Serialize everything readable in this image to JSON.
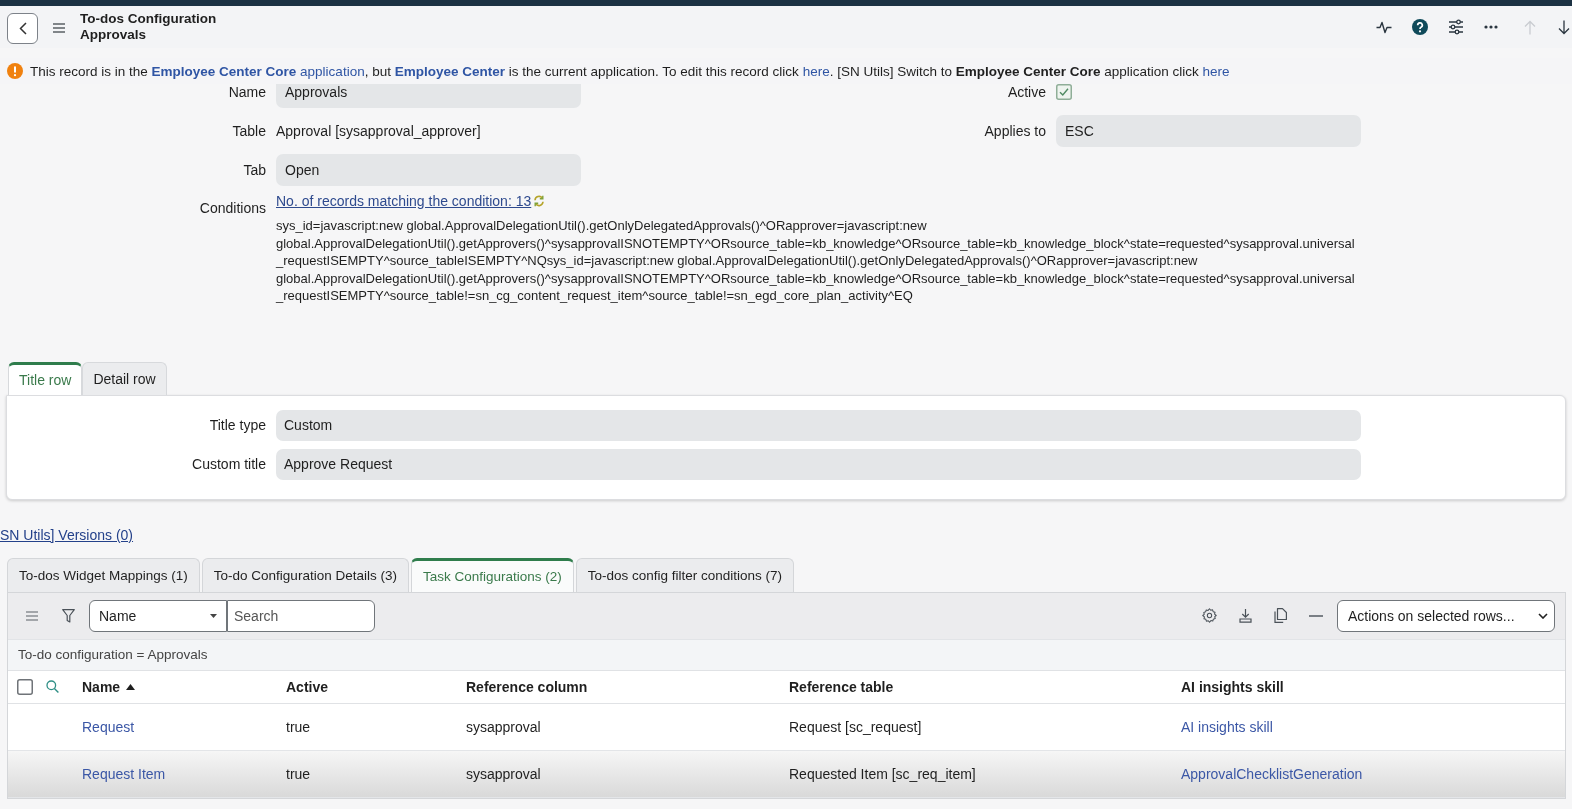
{
  "header": {
    "title": "To-dos Configuration",
    "subtitle": "Approvals",
    "previous_disabled": true,
    "next_disabled": false
  },
  "info_message": {
    "parts": [
      {
        "kind": "text",
        "text": "This record is in the "
      },
      {
        "kind": "link",
        "bold": false,
        "text": "**Employee Center Core** application"
      },
      {
        "kind": "text",
        "text": ", but "
      },
      {
        "kind": "link",
        "bold": true,
        "text": "Employee Center"
      },
      {
        "kind": "text",
        "text": " is the current application. To edit this record click "
      },
      {
        "kind": "link",
        "bold": false,
        "text": "here"
      },
      {
        "kind": "text",
        "text": ".  [SN Utils] Switch to **Employee Center Core** application click "
      },
      {
        "kind": "link",
        "bold": false,
        "text": "here"
      }
    ]
  },
  "form": {
    "left_fields": [
      {
        "kind": "input",
        "label": "Name",
        "value": "Approvals"
      },
      {
        "kind": "text",
        "label": "Table",
        "value": "Approval [sysapproval_approver]"
      },
      {
        "kind": "input",
        "label": "Tab",
        "value": "Open"
      }
    ],
    "right_fields": [
      {
        "kind": "checkbox",
        "label": "Active",
        "checked": true
      },
      {
        "kind": "input",
        "label": "Applies to",
        "value": "ESC"
      }
    ],
    "conditions": {
      "label": "Conditions",
      "count_link": "No. of records matching the condition: 13",
      "query": "sys_id=javascript:new global.ApprovalDelegationUtil().getOnlyDelegatedApprovals()^ORapprover=javascript:new global.ApprovalDelegationUtil().getApprovers()^sysapprovalISNOTEMPTY^ORsource_table=kb_knowledge^ORsource_table=kb_knowledge_block^state=requested^sysapproval.universal_requestISEMPTY^source_tableISEMPTY^NQsys_id=javascript:new global.ApprovalDelegationUtil().getOnlyDelegatedApprovals()^ORapprover=javascript:new global.ApprovalDelegationUtil().getApprovers()^sysapprovalISNOTEMPTY^ORsource_table=kb_knowledge^ORsource_table=kb_knowledge_block^state=requested^sysapproval.universal_requestISEMPTY^source_table!=sn_cg_content_request_item^source_table!=sn_egd_core_plan_activity^EQ"
    }
  },
  "section_tabs": [
    {
      "label": "Title row",
      "selected": true
    },
    {
      "label": "Detail row",
      "selected": false
    }
  ],
  "section_fields": [
    {
      "label": "Title type",
      "value": "Custom"
    },
    {
      "label": "Custom title",
      "value": "Approve Request"
    }
  ],
  "versions_link": "SN Utils] Versions (0)",
  "related_lists": {
    "tabs": [
      {
        "label": "To-dos Widget Mappings (1)",
        "selected": false
      },
      {
        "label": "To-do Configuration Details (3)",
        "selected": false
      },
      {
        "label": "Task Configurations (2)",
        "selected": true
      },
      {
        "label": "To-dos config filter conditions (7)",
        "selected": false
      }
    ],
    "toolbar": {
      "field_select": "Name",
      "search_placeholder": "Search",
      "actions_select": "Actions on selected rows..."
    },
    "breadcrumb": "To-do configuration = Approvals",
    "table": {
      "select_all_checked": false,
      "columns": [
        {
          "label": "Name",
          "sorted_ascending": true
        },
        {
          "label": "Active",
          "sorted_ascending": false
        },
        {
          "label": "Reference column",
          "sorted_ascending": false
        },
        {
          "label": "Reference table",
          "sorted_ascending": false
        },
        {
          "label": "AI insights skill",
          "sorted_ascending": false
        }
      ],
      "rows": [
        {
          "hovered": false,
          "cells": [
            {
              "kind": "link",
              "text": "Request"
            },
            {
              "kind": "text",
              "text": "true"
            },
            {
              "kind": "text",
              "text": "sysapproval"
            },
            {
              "kind": "text",
              "text": "Request [sc_request]"
            },
            {
              "kind": "link",
              "text": "AI insights skill"
            }
          ]
        },
        {
          "hovered": true,
          "cells": [
            {
              "kind": "link",
              "text": "Request Item"
            },
            {
              "kind": "text",
              "text": "true"
            },
            {
              "kind": "text",
              "text": "sysapproval"
            },
            {
              "kind": "text",
              "text": "Requested Item [sc_req_item]"
            },
            {
              "kind": "link",
              "text": "ApprovalChecklistGeneration"
            }
          ]
        }
      ]
    }
  }
}
